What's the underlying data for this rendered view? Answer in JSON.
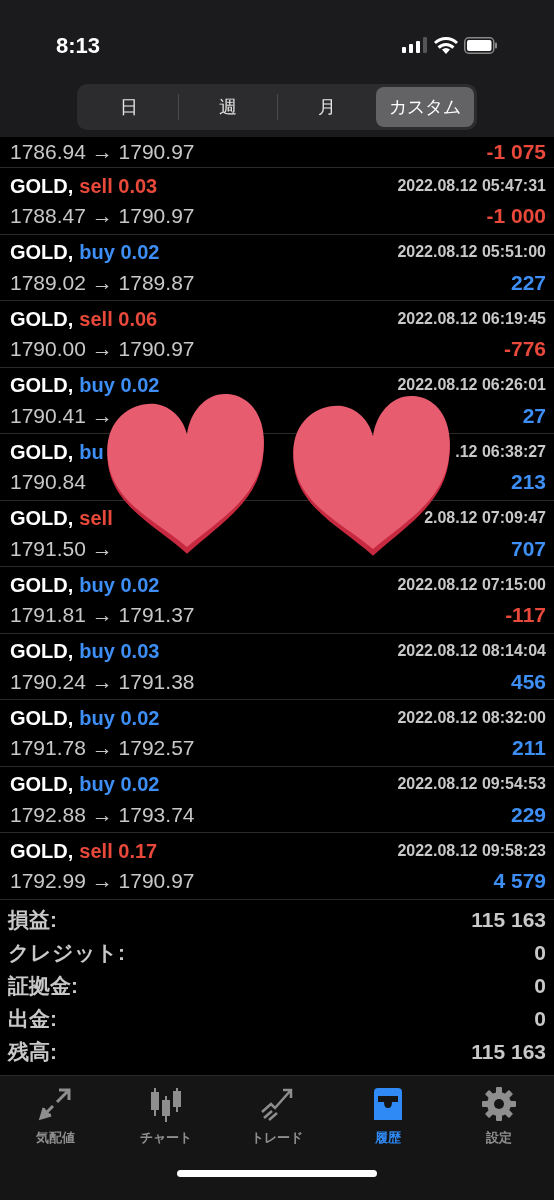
{
  "status_bar": {
    "time": "8:13"
  },
  "period_tabs": [
    {
      "label": "日",
      "selected": false
    },
    {
      "label": "週",
      "selected": false
    },
    {
      "label": "月",
      "selected": false
    },
    {
      "label": "カスタム",
      "selected": true
    }
  ],
  "trades": [
    {
      "prices": "1786.94 → 1790.97",
      "profit": "-1 075",
      "negative": true
    },
    {
      "symbol": "GOLD,",
      "order": "sell 0.03",
      "kind": "sell",
      "time": "2022.08.12 05:47:31",
      "prices": "1788.47 → 1790.97",
      "profit": "-1 000",
      "negative": true
    },
    {
      "symbol": "GOLD,",
      "order": "buy 0.02",
      "kind": "buy",
      "time": "2022.08.12 05:51:00",
      "prices": "1789.02 → 1789.87",
      "profit": "227",
      "negative": false
    },
    {
      "symbol": "GOLD,",
      "order": "sell 0.06",
      "kind": "sell",
      "time": "2022.08.12 06:19:45",
      "prices": "1790.00 → 1790.97",
      "profit": "-776",
      "negative": true
    },
    {
      "symbol": "GOLD,",
      "order": "buy 0.02",
      "kind": "buy",
      "time": "2022.08.12 06:26:01",
      "prices": "1790.41 →",
      "profit": "27",
      "negative": false
    },
    {
      "symbol": "GOLD,",
      "order": "bu",
      "kind": "buy",
      "time": ".12 06:38:27",
      "prices": "1790.84",
      "profit": "213",
      "negative": false
    },
    {
      "symbol": "GOLD,",
      "order": "sell",
      "kind": "sell",
      "time": "2.08.12 07:09:47",
      "prices": "1791.50 →",
      "profit": "707",
      "negative": false
    },
    {
      "symbol": "GOLD,",
      "order": "buy 0.02",
      "kind": "buy",
      "time": "2022.08.12 07:15:00",
      "prices": "1791.81 → 1791.37",
      "profit": "-117",
      "negative": true
    },
    {
      "symbol": "GOLD,",
      "order": "buy 0.03",
      "kind": "buy",
      "time": "2022.08.12 08:14:04",
      "prices": "1790.24 → 1791.38",
      "profit": "456",
      "negative": false
    },
    {
      "symbol": "GOLD,",
      "order": "buy 0.02",
      "kind": "buy",
      "time": "2022.08.12 08:32:00",
      "prices": "1791.78 → 1792.57",
      "profit": "211",
      "negative": false
    },
    {
      "symbol": "GOLD,",
      "order": "buy 0.02",
      "kind": "buy",
      "time": "2022.08.12 09:54:53",
      "prices": "1792.88 → 1793.74",
      "profit": "229",
      "negative": false
    },
    {
      "symbol": "GOLD,",
      "order": "sell 0.17",
      "kind": "sell",
      "time": "2022.08.12 09:58:23",
      "prices": "1792.99 → 1790.97",
      "profit": "4 579",
      "negative": false
    }
  ],
  "summary": [
    {
      "label": "損益:",
      "value": "115 163"
    },
    {
      "label": "クレジット:",
      "value": "0"
    },
    {
      "label": "証拠金:",
      "value": "0"
    },
    {
      "label": "出金:",
      "value": "0"
    },
    {
      "label": "残高:",
      "value": "115 163"
    }
  ],
  "tab_bar": [
    {
      "label": "気配値",
      "kind": "quotes",
      "selected": false
    },
    {
      "label": "チャート",
      "kind": "chart",
      "selected": false
    },
    {
      "label": "トレード",
      "kind": "trade",
      "selected": false
    },
    {
      "label": "履歴",
      "kind": "history",
      "selected": true
    },
    {
      "label": "設定",
      "kind": "settings",
      "selected": false
    }
  ]
}
